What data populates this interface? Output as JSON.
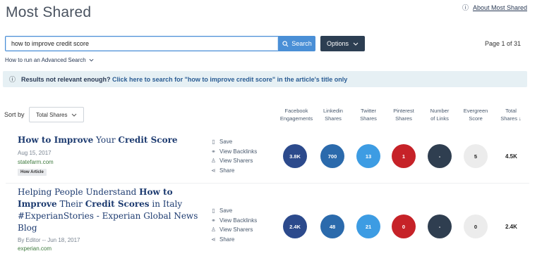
{
  "page": {
    "title": "Most Shared",
    "about_link": "About Most Shared",
    "info_glyph": "ⓘ"
  },
  "search": {
    "value": "how to improve credit score",
    "placeholder": "",
    "button_label": "Search",
    "button_icon": "search-icon",
    "options_label": "Options",
    "options_icon": "chevron-down-icon"
  },
  "pagination": {
    "label": "Page 1 of 31"
  },
  "advanced_search": {
    "label": "How to run an Advanced Search",
    "icon": "chevron-down-icon"
  },
  "relevance_banner": {
    "lead": "Results not relevant enough?",
    "link": "Click here to search for \"how to improve credit score\" in the article's title only"
  },
  "sort": {
    "label": "Sort by",
    "selected": "Total Shares"
  },
  "columns": [
    {
      "key": "facebook",
      "label_line1": "Facebook",
      "label_line2": "Engagements"
    },
    {
      "key": "linkedin",
      "label_line1": "Linkedin",
      "label_line2": "Shares"
    },
    {
      "key": "twitter",
      "label_line1": "Twitter",
      "label_line2": "Shares"
    },
    {
      "key": "pinterest",
      "label_line1": "Pinterest",
      "label_line2": "Shares"
    },
    {
      "key": "links",
      "label_line1": "Number",
      "label_line2": "of Links"
    },
    {
      "key": "evergreen",
      "label_line1": "Evergreen",
      "label_line2": "Score"
    },
    {
      "key": "total",
      "label_line1": "Total",
      "label_line2": "Shares ↓"
    }
  ],
  "colors": {
    "facebook": "#2c4a8c",
    "linkedin": "#2b6aac",
    "twitter": "#3d9ce3",
    "pinterest": "#c62228",
    "links": "#2f3e50",
    "evergreen": "#ececec",
    "accent": "#4a8fd6",
    "dark": "#2c3e52"
  },
  "actions": {
    "save": "Save",
    "backlinks": "View Backlinks",
    "sharers": "View Sharers",
    "share": "Share"
  },
  "results": [
    {
      "title_parts": [
        {
          "text": "How to Improve",
          "bold": true
        },
        {
          "text": " Your ",
          "bold": false
        },
        {
          "text": "Credit Score",
          "bold": true
        }
      ],
      "meta": "Aug 15, 2017",
      "domain": "statefarm.com",
      "tag": "How Article",
      "facebook": "3.8K",
      "linkedin": "700",
      "twitter": "13",
      "pinterest": "1",
      "links": "-",
      "evergreen": "5",
      "total": "4.5K"
    },
    {
      "title_parts": [
        {
          "text": "Helping People Understand ",
          "bold": false
        },
        {
          "text": "How to Improve",
          "bold": true
        },
        {
          "text": " Their ",
          "bold": false
        },
        {
          "text": "Credit Scores",
          "bold": true
        },
        {
          "text": " in Italy #ExperianStories - Experian Global News Blog",
          "bold": false
        }
      ],
      "meta": "By Editor -- Jun 18, 2017",
      "domain": "experian.com",
      "tag": "",
      "facebook": "2.4K",
      "linkedin": "48",
      "twitter": "21",
      "pinterest": "0",
      "links": "-",
      "evergreen": "0",
      "total": "2.4K"
    }
  ]
}
